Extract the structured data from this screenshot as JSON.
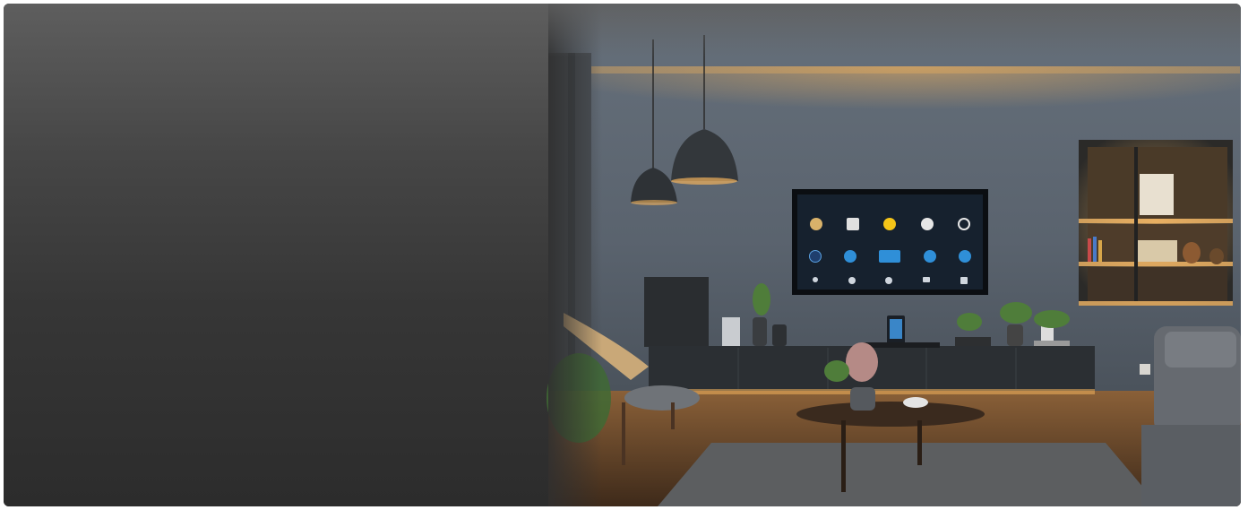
{
  "hero": {
    "image_alt_semantic": "smart-home-living-room-photo",
    "colors": {
      "panel": "#3a3a3a",
      "wall": "#5b6470",
      "warm_light": "#f2b25c",
      "floor": "#6b4a2e",
      "tv_screen": "#16212e",
      "tv_accent": "#2f8fd8"
    }
  }
}
